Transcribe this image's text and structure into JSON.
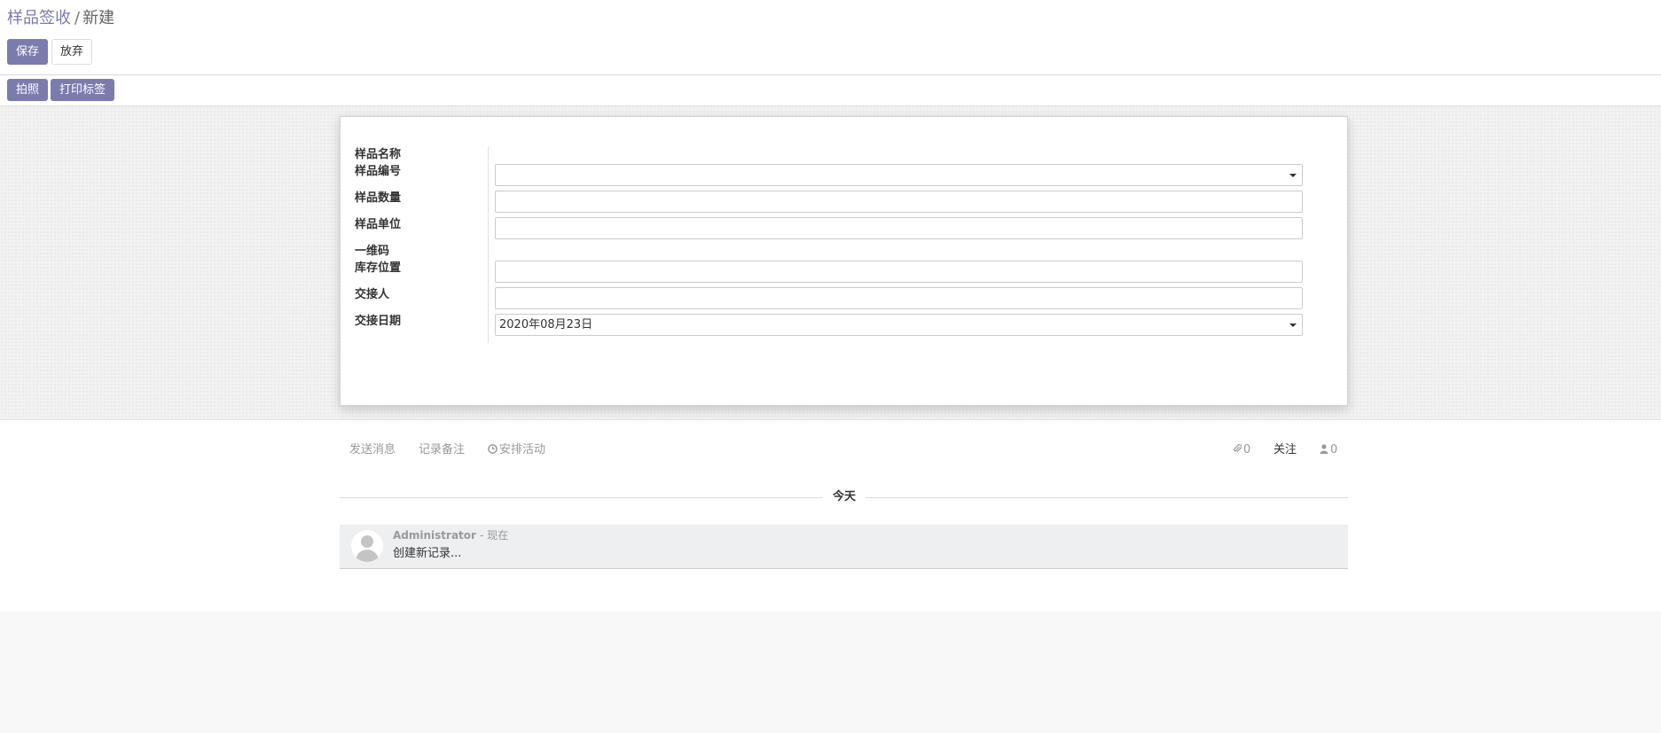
{
  "breadcrumb": {
    "parent": "样品签收",
    "separator": "/",
    "current": "新建"
  },
  "toolbar": {
    "save_label": "保存",
    "discard_label": "放弃"
  },
  "statusbar": {
    "photo_label": "拍照",
    "print_label": "打印标签"
  },
  "form": {
    "fields": [
      {
        "label": "样品名称"
      },
      {
        "label": "样品编号",
        "value": ""
      },
      {
        "label": "样品数量",
        "value": ""
      },
      {
        "label": "样品单位",
        "value": ""
      },
      {
        "label": "一维码"
      },
      {
        "label": "库存位置",
        "value": ""
      },
      {
        "label": "交接人",
        "value": ""
      },
      {
        "label": "交接日期",
        "value": "2020年08月23日"
      }
    ]
  },
  "chatter": {
    "send_message": "发送消息",
    "log_note": "记录备注",
    "schedule_activity": "安排活动",
    "attachments_count": "0",
    "follow_label": "关注",
    "followers_count": "0",
    "date_separator": "今天",
    "message": {
      "author": "Administrator",
      "date": "- 现在",
      "body": "创建新记录..."
    }
  },
  "colors": {
    "primary": "#7c7bad",
    "sheet_bg": "#f2f2f2"
  }
}
